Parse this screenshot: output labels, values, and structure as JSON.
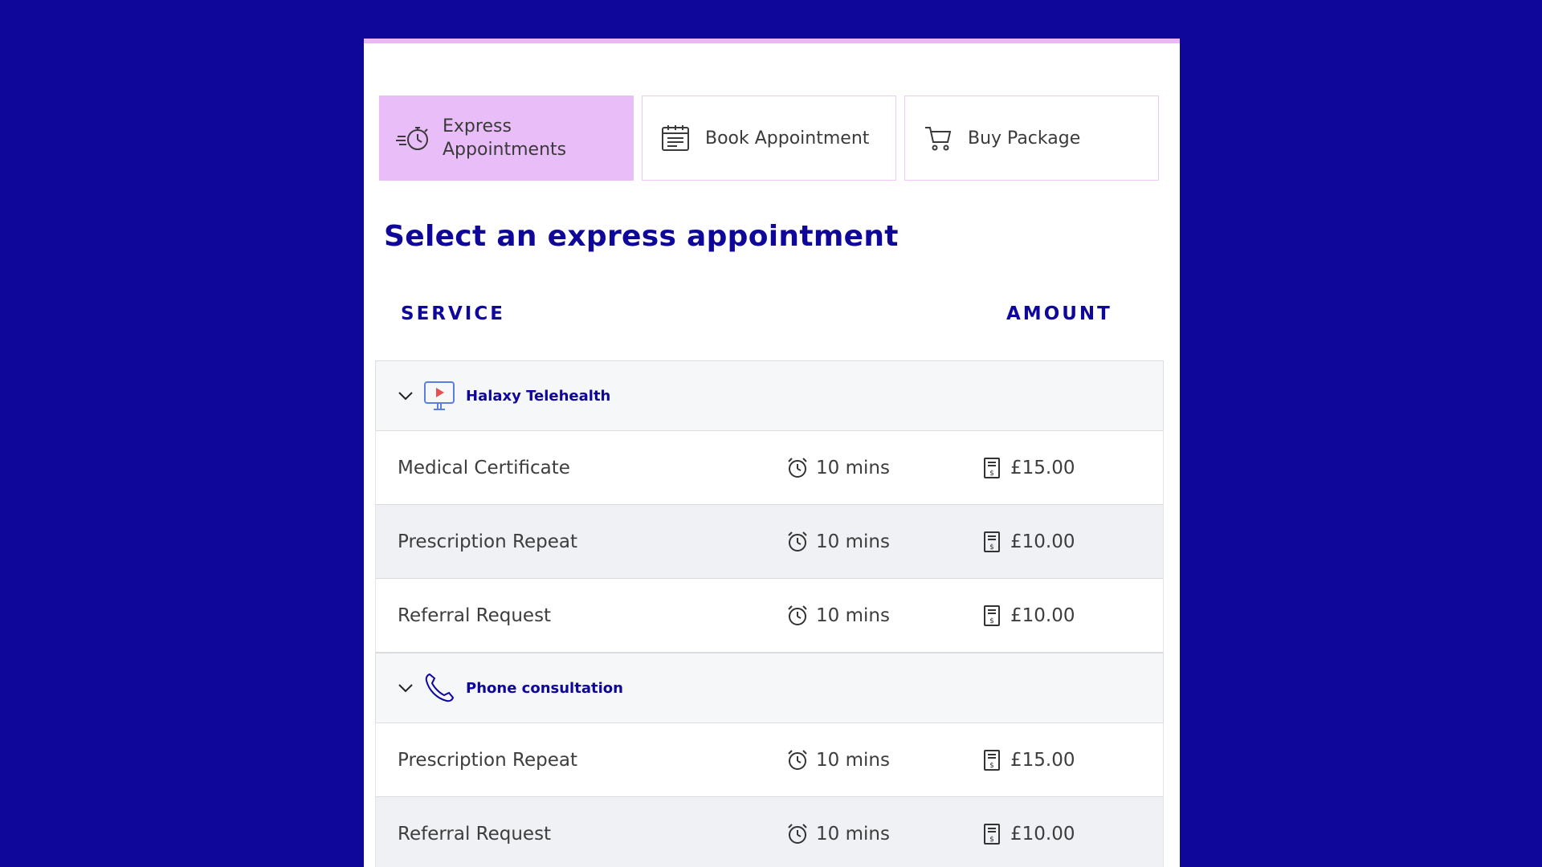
{
  "tabs": [
    {
      "label": "Express Appointments",
      "icon": "stopwatch-icon",
      "active": true
    },
    {
      "label": "Book Appointment",
      "icon": "calendar-icon",
      "active": false
    },
    {
      "label": "Buy Package",
      "icon": "cart-icon",
      "active": false
    }
  ],
  "heading": "Select an express appointment",
  "columns": {
    "service": "SERVICE",
    "amount": "AMOUNT"
  },
  "groups": [
    {
      "name": "Halaxy Telehealth",
      "icon": "video-monitor-icon",
      "rows": [
        {
          "service": "Medical Certificate",
          "duration": "10 mins",
          "price": "£15.00"
        },
        {
          "service": "Prescription Repeat",
          "duration": "10 mins",
          "price": "£10.00"
        },
        {
          "service": "Referral Request",
          "duration": "10 mins",
          "price": "£10.00"
        }
      ]
    },
    {
      "name": "Phone consultation",
      "icon": "phone-icon",
      "rows": [
        {
          "service": "Prescription Repeat",
          "duration": "10 mins",
          "price": "£15.00"
        },
        {
          "service": "Referral Request",
          "duration": "10 mins",
          "price": "£10.00"
        }
      ]
    }
  ],
  "colors": {
    "background": "#0e0799",
    "accent": "#e9bdf7",
    "heading": "#0e0799"
  }
}
